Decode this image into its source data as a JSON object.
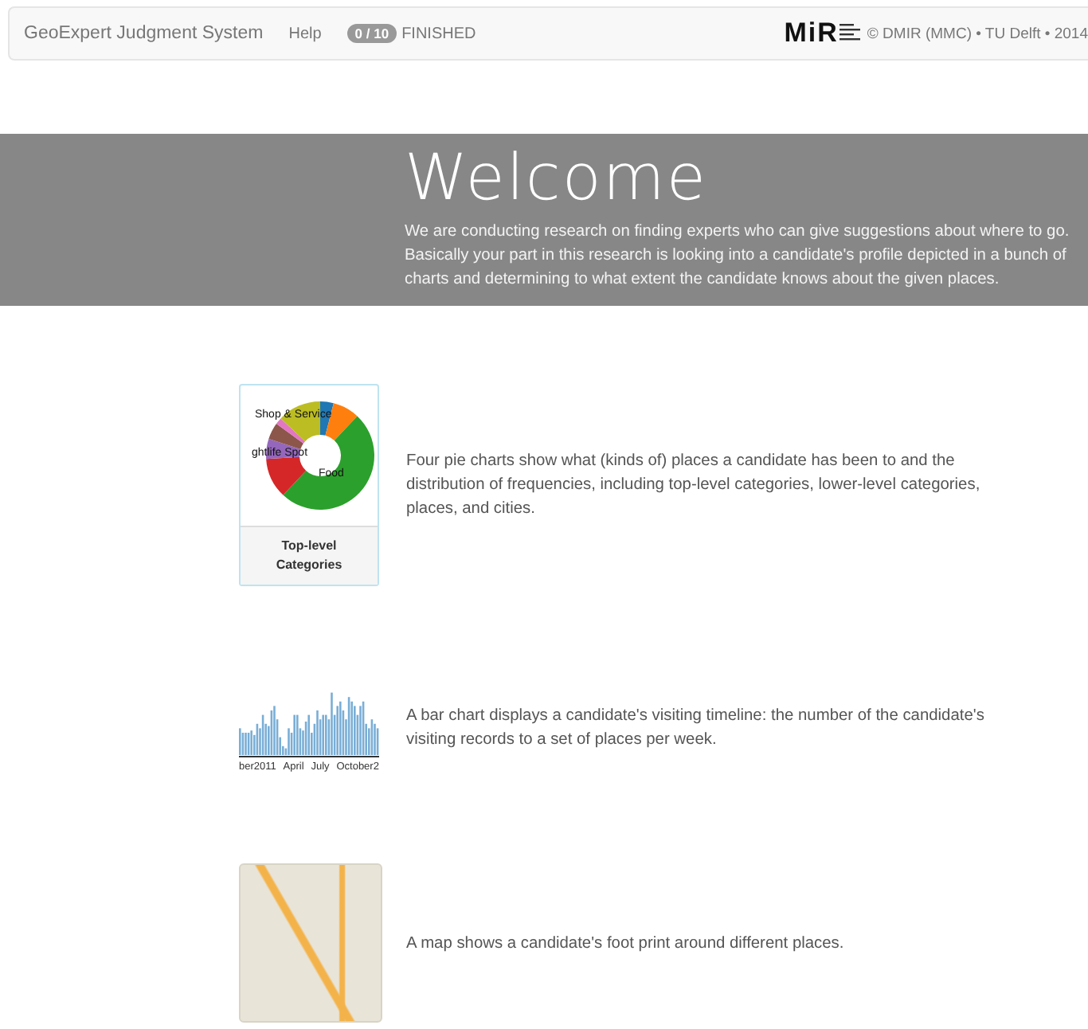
{
  "navbar": {
    "brand": "GeoExpert Judgment System",
    "links": [
      "Help"
    ],
    "progress_badge": "0 / 10",
    "progress_label": "FINISHED",
    "logo_text": "MiR",
    "copyright": "© DMIR (MMC) • TU Delft • 2014"
  },
  "hero": {
    "title": "Welcome",
    "text": "We are conducting research on finding experts who can give suggestions about where to go. Basically your part in this research is looking into a candidate's profile depicted in a bunch of charts and determining to what extent the candidate knows about the given places."
  },
  "features": [
    {
      "kind": "pie",
      "pie_labels": [
        "Shop & Service",
        "ghtlife Spot",
        "Food"
      ],
      "caption": "Top-level Categories",
      "text": "Four pie charts show what (kinds of) places a candidate has been to and the distribution of frequencies, including top-level categories, lower-level categories, places, and cities."
    },
    {
      "kind": "bars",
      "axis_labels": [
        "ber2011",
        "April",
        "July",
        "October2"
      ],
      "text": "A bar chart displays a candidate's visiting timeline: the number of the candidate's visiting records to a set of places per week."
    },
    {
      "kind": "map",
      "text": "A map shows a candidate's foot print around different places."
    }
  ]
}
